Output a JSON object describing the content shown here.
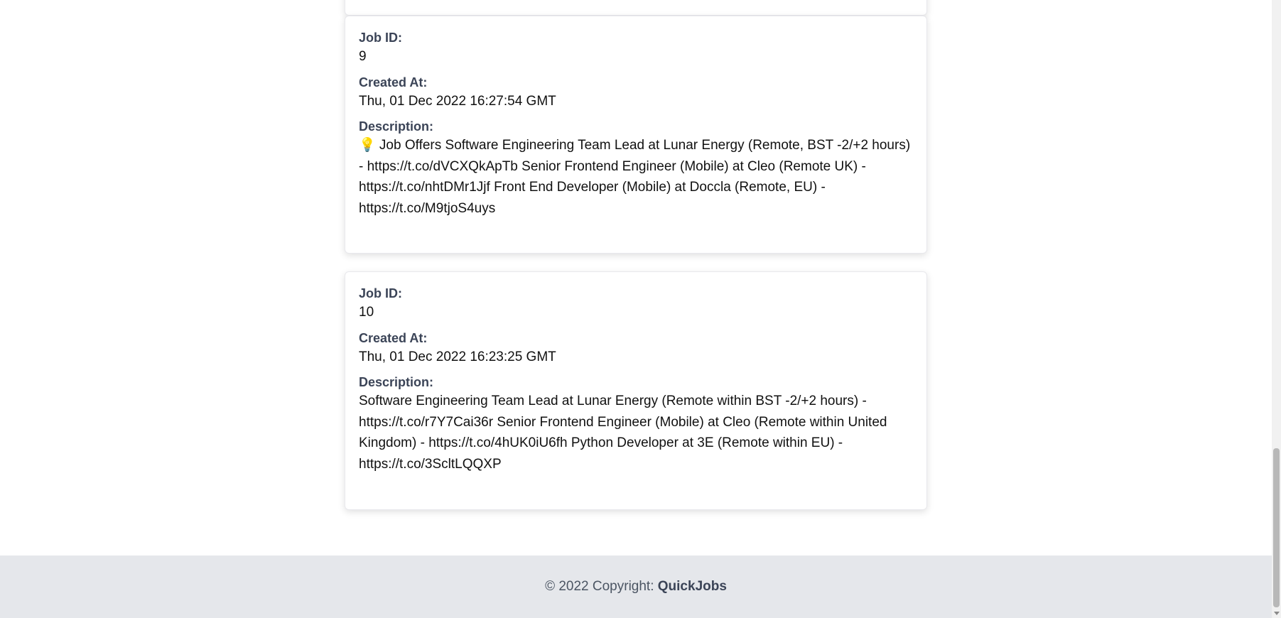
{
  "jobs": [
    {
      "id_label": "Job ID:",
      "id": "9",
      "created_label": "Created At:",
      "created_at": "Thu, 01 Dec 2022 16:27:54 GMT",
      "description_label": "Description:",
      "description": "💡 Job Offers Software Engineering Team Lead at Lunar Energy (Remote, BST -2/+2 hours) - https://t.co/dVCXQkApTb Senior Frontend Engineer (Mobile) at Cleo (Remote UK) - https://t.co/nhtDMr1Jjf Front End Developer (Mobile) at Doccla (Remote, EU) - https://t.co/M9tjoS4uys"
    },
    {
      "id_label": "Job ID:",
      "id": "10",
      "created_label": "Created At:",
      "created_at": "Thu, 01 Dec 2022 16:23:25 GMT",
      "description_label": "Description:",
      "description": "Software Engineering Team Lead at Lunar Energy (Remote within BST -2/+2 hours) - https://t.co/r7Y7Cai36r Senior Frontend Engineer (Mobile) at Cleo (Remote within United Kingdom) - https://t.co/4hUK0iU6fh Python Developer at 3E (Remote within EU) - https://t.co/3ScltLQQXP"
    }
  ],
  "footer": {
    "copyright": "© 2022 Copyright: ",
    "brand": "QuickJobs"
  },
  "colors": {
    "label": "#3b4457",
    "footer_bg": "#e5e7eb",
    "card_border": "#e8e8ec"
  }
}
